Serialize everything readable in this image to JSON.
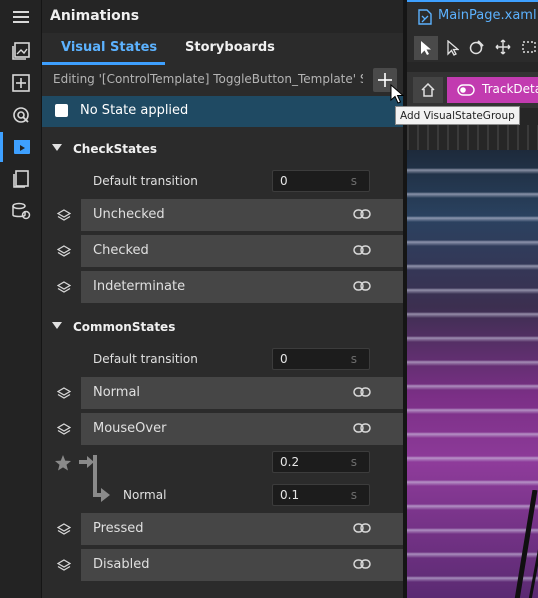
{
  "rail": {
    "items": [
      {
        "name": "menu-icon"
      },
      {
        "name": "assets-icon"
      },
      {
        "name": "add-icon"
      },
      {
        "name": "target-icon"
      },
      {
        "name": "animations-icon"
      },
      {
        "name": "bookmark-icon"
      },
      {
        "name": "data-icon"
      }
    ]
  },
  "panel": {
    "title": "Animations",
    "tabs": [
      "Visual States",
      "Storyboards"
    ],
    "active_tab": "Visual States",
    "editing_text": "Editing '[ControlTemplate] ToggleButton_Template' S...",
    "no_state_label": "No State applied"
  },
  "groups": [
    {
      "name": "CheckStates",
      "default_transition_label": "Default transition",
      "default_transition_value": "0",
      "unit": "s",
      "states": [
        "Unchecked",
        "Checked",
        "Indeterminate"
      ]
    },
    {
      "name": "CommonStates",
      "default_transition_label": "Default transition",
      "default_transition_value": "0",
      "unit": "s",
      "states": [
        "Normal",
        "MouseOver",
        "Pressed",
        "Disabled"
      ],
      "transition_from_mouseover_any": "0.2",
      "transition_to_normal_label": "Normal",
      "transition_to_normal_value": "0.1"
    }
  ],
  "designer": {
    "doc_tab": "MainPage.xaml",
    "breadcrumb": "TrackDeta"
  },
  "tooltip": "Add VisualStateGroup"
}
